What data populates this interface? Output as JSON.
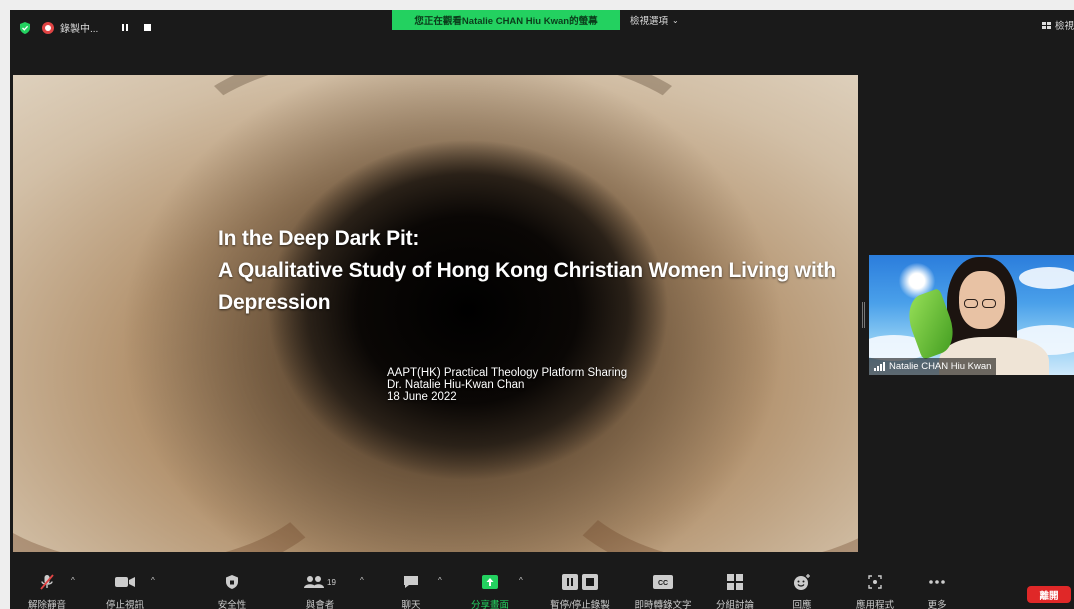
{
  "topbar": {
    "recording_label": "錄製中...",
    "viewing_banner": "您正在觀看Natalie CHAN Hiu Kwan的螢幕",
    "view_options_label": "檢視選項",
    "view_label": "檢視"
  },
  "slide": {
    "title_line1": "In the Deep Dark Pit:",
    "title_line2": "A Qualitative Study of Hong Kong Christian Women Living with",
    "title_line3": "Depression",
    "sub_line1": "AAPT(HK) Practical Theology Platform Sharing",
    "sub_line2": "Dr. Natalie Hiu-Kwan Chan",
    "sub_line3": "18 June 2022"
  },
  "participant": {
    "name": "Natalie CHAN Hiu Kwan"
  },
  "toolbar": {
    "unmute": "解除靜音",
    "stop_video": "停止視訊",
    "security": "安全性",
    "participants": "與會者",
    "participants_count": "19",
    "chat": "聊天",
    "share_screen": "分享畫面",
    "pause_stop_recording": "暫停/停止錄製",
    "live_transcript": "即時轉錄文字",
    "breakout_rooms": "分組討論",
    "reactions": "回應",
    "apps": "應用程式",
    "more": "更多",
    "leave": "離開"
  },
  "colors": {
    "accent_green": "#23d160",
    "leave_red": "#e02828",
    "mute_red": "#e04444"
  }
}
